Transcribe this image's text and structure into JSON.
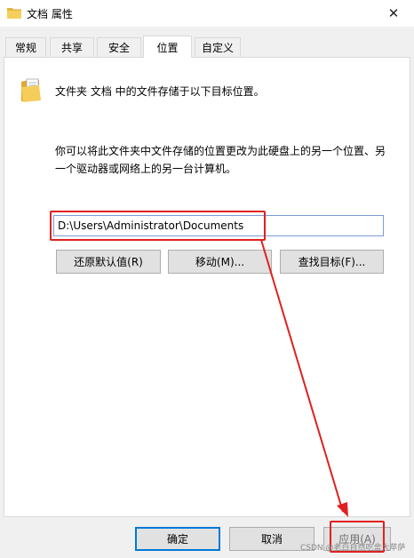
{
  "window": {
    "title": "文档 属性",
    "close_glyph": "✕",
    "icon": "folder-icon"
  },
  "tabs": [
    {
      "label": "常规",
      "active": false
    },
    {
      "label": "共享",
      "active": false
    },
    {
      "label": "安全",
      "active": false
    },
    {
      "label": "位置",
      "active": true
    },
    {
      "label": "自定义",
      "active": false
    }
  ],
  "location": {
    "description": "文件夹 文档 中的文件存储于以下目标位置。",
    "hint": "你可以将此文件夹中文件存储的位置更改为此硬盘上的另一个位置、另一个驱动器或网络上的另一台计算机。",
    "path_value": "D:\\Users\\Administrator\\Documents",
    "restore_button": "还原默认值(R)",
    "move_button": "移动(M)...",
    "find_target_button": "查找目标(F)..."
  },
  "footer": {
    "ok": "确定",
    "cancel": "取消",
    "apply": "应用(A)"
  },
  "annotation": {
    "color": "#e02020"
  },
  "watermark": "CSDN @老白自然吃盒大苹萨"
}
